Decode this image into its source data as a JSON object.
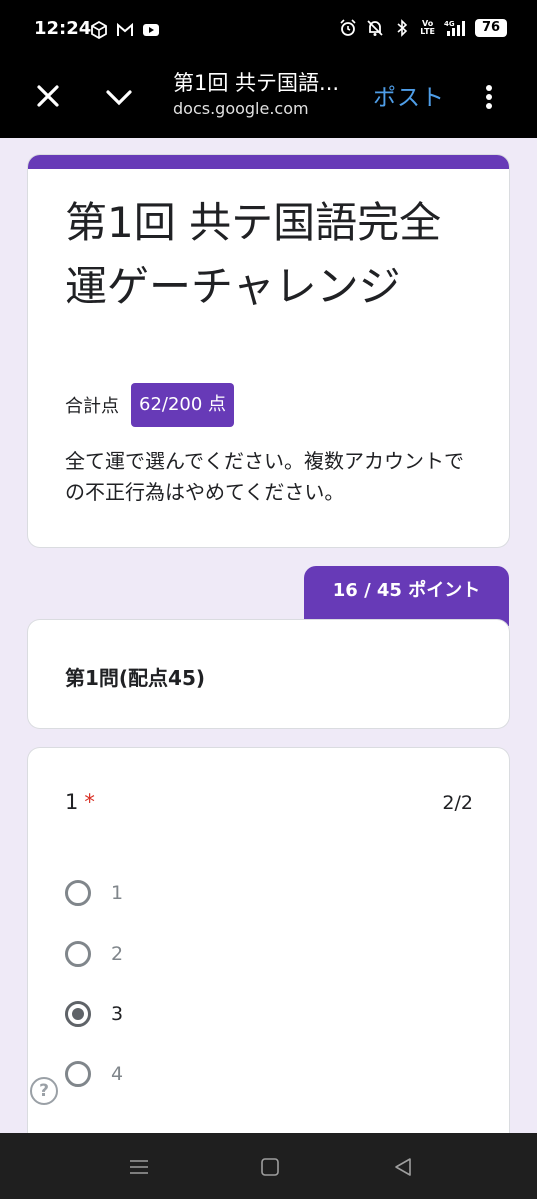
{
  "status": {
    "time": "12:24",
    "network_top": "4G",
    "volte_top": "Vo",
    "volte_bottom": "LTE",
    "battery": "76"
  },
  "app_bar": {
    "title": "第1回 共テ国語...",
    "url": "docs.google.com",
    "post_label": "ポスト"
  },
  "form": {
    "title": "第1回 共テ国語完全運ゲーチャレンジ",
    "score_label": "合計点",
    "score_value": "62/200 点",
    "description": "全て運で選んでください。複数アカウントでの不正行為はやめてください。"
  },
  "section": {
    "points": "16 / 45 ポイント",
    "title": "第1問(配点45)"
  },
  "question": {
    "number": "1",
    "required_mark": "*",
    "score": "2/2",
    "options": [
      {
        "label": "1",
        "selected": false
      },
      {
        "label": "2",
        "selected": false
      },
      {
        "label": "3",
        "selected": true
      },
      {
        "label": "4",
        "selected": false
      }
    ]
  },
  "help": {
    "label": "?"
  },
  "colors": {
    "accent": "#673ab7",
    "post_link": "#4f9ee8",
    "required": "#d93025",
    "background": "#efeaf7"
  }
}
